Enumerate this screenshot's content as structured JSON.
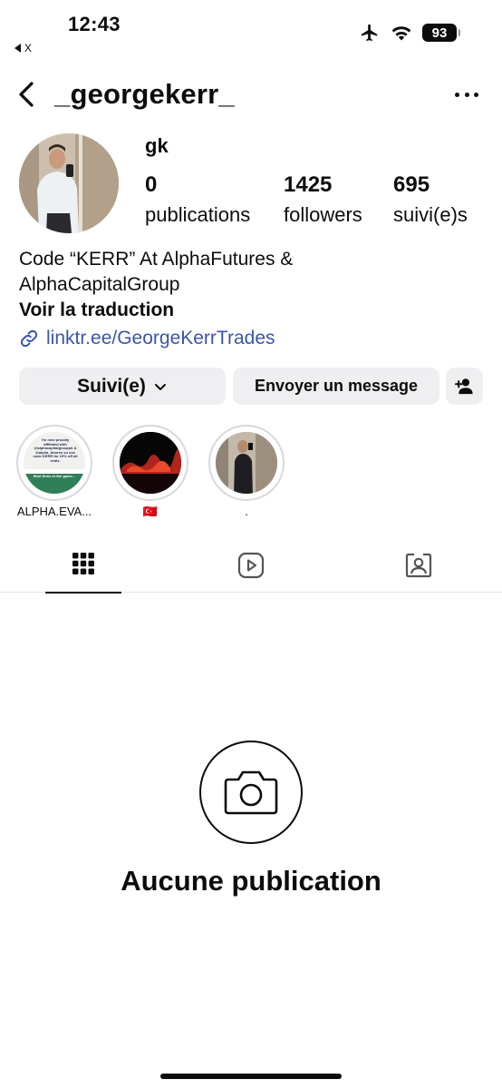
{
  "status_bar": {
    "time": "12:43",
    "back_app_label": "X",
    "battery": "93",
    "icons": [
      "airplane-icon",
      "wifi-icon",
      "battery-icon"
    ]
  },
  "header": {
    "username": "_georgekerr_",
    "icons": [
      "back-chevron-icon",
      "more-options-icon"
    ]
  },
  "profile": {
    "display_name": "gk",
    "stats": [
      {
        "value": "0",
        "label": "publications"
      },
      {
        "value": "1425",
        "label": "followers"
      },
      {
        "value": "695",
        "label": "suivi(e)s"
      }
    ],
    "bio_lines": [
      "Code “KERR” At AlphaFutures &",
      "AlphaCapitalGroup"
    ],
    "translate_label": "Voir la traduction",
    "link": "linktr.ee/GeorgeKerrTrades"
  },
  "buttons": {
    "follow_label": "Suivi(e)",
    "message_label": "Envoyer un message"
  },
  "highlights": [
    {
      "label": "ALPHA.EVA...",
      "card_text": [
        "I'm now proudly",
        "affiliated with",
        "@alphacapitalgroupuk &",
        "@alpha_futures so use",
        "code KERR for 10% off all",
        "evals."
      ],
      "card_footer": "Best firms in the game..."
    },
    {
      "label": "🇹🇷"
    },
    {
      "label": "."
    }
  ],
  "tabs": [
    "grid-icon",
    "reels-icon",
    "tagged-icon"
  ],
  "empty_state": {
    "title": "Aucune publication",
    "icon": "camera-icon"
  },
  "colors": {
    "link": "#3b56a6",
    "button_bg": "#efeff1",
    "text": "#0c0c0c"
  }
}
